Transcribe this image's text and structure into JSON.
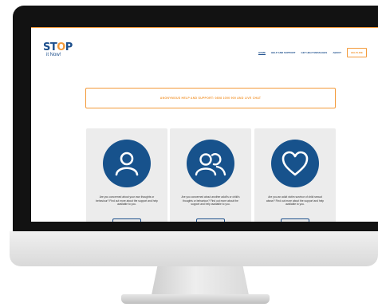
{
  "site": {
    "logo": {
      "word": "STOP",
      "sub": "it Now!",
      "tagline": ""
    },
    "nav": [
      {
        "label": "HOME",
        "active": true
      },
      {
        "label": "HELP AND SUPPORT",
        "active": false
      },
      {
        "label": "GET HELP MESSAGES",
        "active": false
      },
      {
        "label": "ABOUT",
        "active": false
      }
    ],
    "helpline_label": "HELPLINE",
    "banner": "ANONYMOUS HELP AND SUPPORT: 0808 1000 900 AND LIVE CHAT",
    "cards": [
      {
        "icon": "person-icon",
        "text": "Are you concerned about your own thoughts or behaviour? Find out more about the support and help available to you."
      },
      {
        "icon": "two-people-icon",
        "text": "Are you concerned about another adult's or child's thoughts or behaviour? Find out more about the support and help available to you."
      },
      {
        "icon": "heart-icon",
        "text": "Are you an adult victim survivor of child sexual abuse? Find out more about the support and help available to you."
      }
    ]
  },
  "colors": {
    "brand_blue": "#17528c",
    "accent_orange": "#f39a3a",
    "card_bg": "#ececec"
  }
}
